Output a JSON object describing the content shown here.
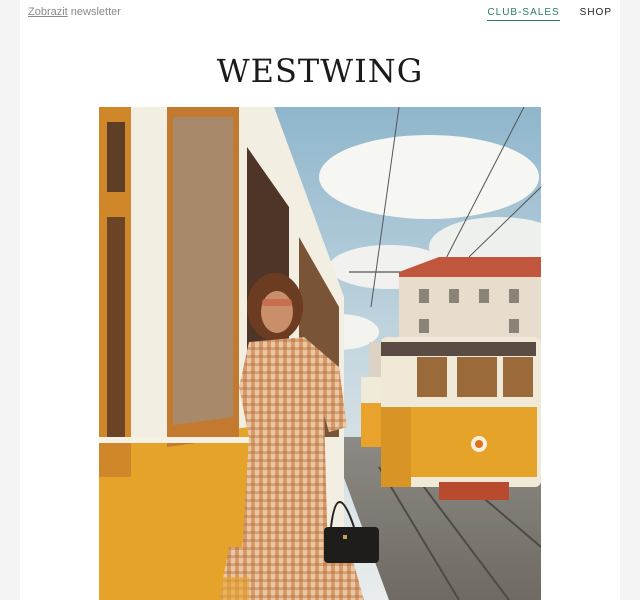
{
  "header": {
    "view_link": "Zobrazit",
    "view_suffix": " newsletter",
    "nav": {
      "club_sales": "CLUB-SALES",
      "shop": "SHOP"
    }
  },
  "brand": {
    "logo_text": "WESTWING"
  },
  "hero": {
    "tram_color": "#e6a32a"
  }
}
